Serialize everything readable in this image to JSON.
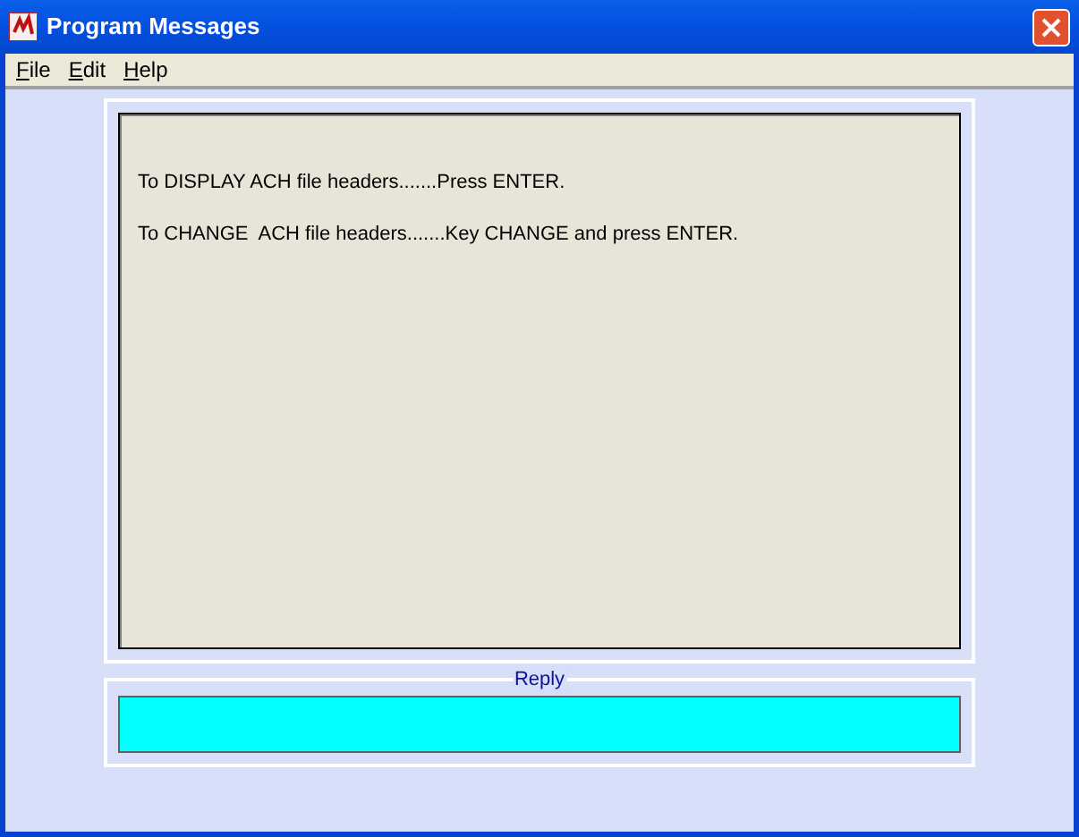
{
  "window": {
    "title": "Program Messages"
  },
  "menu": [
    "File",
    "Edit",
    "Help"
  ],
  "messages": [
    "To DISPLAY ACH file headers.......Press ENTER.",
    "To CHANGE  ACH file headers.......Key CHANGE and press ENTER."
  ],
  "reply": {
    "label": "Reply"
  }
}
